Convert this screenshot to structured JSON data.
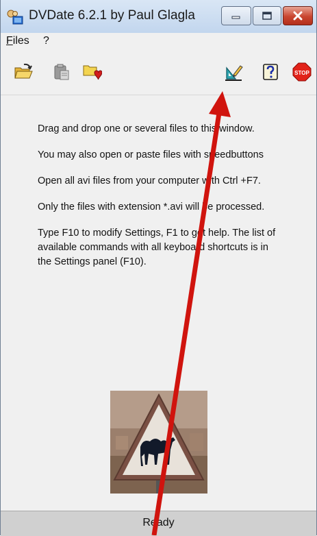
{
  "window": {
    "title": "DVDate 6.2.1 by Paul Glagla"
  },
  "menu": {
    "files_accel": "F",
    "files_rest": "iles",
    "help": "?"
  },
  "toolbar": {
    "icons": [
      "open-folder-icon",
      "paste-icon",
      "folder-heart-icon",
      "settings-icon",
      "help-icon",
      "stop-icon"
    ]
  },
  "content": {
    "paragraphs": [
      "Drag and drop one or several files to this window.",
      "You may also open or paste files with speedbuttons",
      "Open all avi files from your computer with Ctrl +F7.",
      "Only the files with extension *.avi will be processed.",
      "Type F10 to modify Settings, F1 to get help. The list of available commands with all keyboard shortcuts is in the Settings panel (F10)."
    ]
  },
  "status": {
    "text": "Ready"
  },
  "colors": {
    "annotation_arrow": "#d0140e",
    "close_button": "#c9452f"
  }
}
